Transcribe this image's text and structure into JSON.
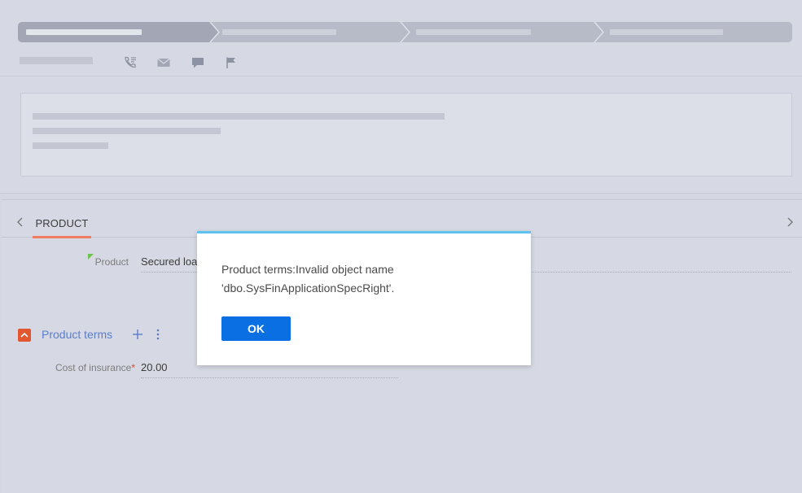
{
  "tabs": {
    "product_label": "PRODUCT"
  },
  "product_field": {
    "label": "Product",
    "value": "Secured loa"
  },
  "product_terms_group": {
    "title": "Product terms"
  },
  "cost_of_insurance": {
    "label": "Cost of insurance",
    "required_mark": "*",
    "value": "20.00"
  },
  "dialog": {
    "message": "Product terms:Invalid object name 'dbo.SysFinApplicationSpecRight'.",
    "ok_label": "OK"
  },
  "icons": [
    "call-icon",
    "email-icon",
    "chat-icon",
    "flag-icon",
    "chevron-left-icon",
    "chevron-right-icon",
    "collapse-icon",
    "plus-icon",
    "more-vertical-icon"
  ],
  "colors": {
    "accent_blue": "#0b6fe4",
    "dialog_top_border": "#5ec2ee",
    "tab_underline": "#ef7e63",
    "group_toggle": "#e2572f",
    "group_title": "#5b7ec8",
    "required": "#d9472f"
  }
}
